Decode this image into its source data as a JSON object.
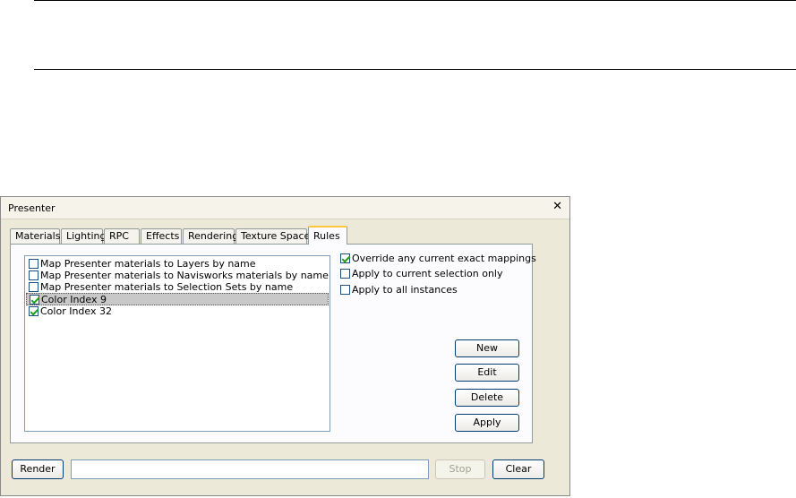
{
  "window": {
    "title": "Presenter"
  },
  "tabs": [
    {
      "label": "Materials"
    },
    {
      "label": "Lighting"
    },
    {
      "label": "RPC"
    },
    {
      "label": "Effects"
    },
    {
      "label": "Rendering"
    },
    {
      "label": "Texture Space"
    },
    {
      "label": "Rules",
      "active": true
    }
  ],
  "rules_list": [
    {
      "label": "Map Presenter materials to Layers by name",
      "checked": false
    },
    {
      "label": "Map Presenter materials to Navisworks materials by name",
      "checked": false
    },
    {
      "label": "Map Presenter materials to Selection Sets by name",
      "checked": false
    },
    {
      "label": "Color Index 9",
      "checked": true,
      "selected": true
    },
    {
      "label": "Color Index 32",
      "checked": true
    }
  ],
  "options": [
    {
      "label": "Override any current exact mappings",
      "checked": true
    },
    {
      "label": "Apply to current selection only",
      "checked": false
    },
    {
      "label": "Apply to all instances",
      "checked": false
    }
  ],
  "buttons": {
    "new": "New",
    "edit": "Edit",
    "delete": "Delete",
    "apply": "Apply",
    "render": "Render",
    "stop": "Stop",
    "clear": "Clear"
  },
  "progress": {
    "value": 0
  }
}
